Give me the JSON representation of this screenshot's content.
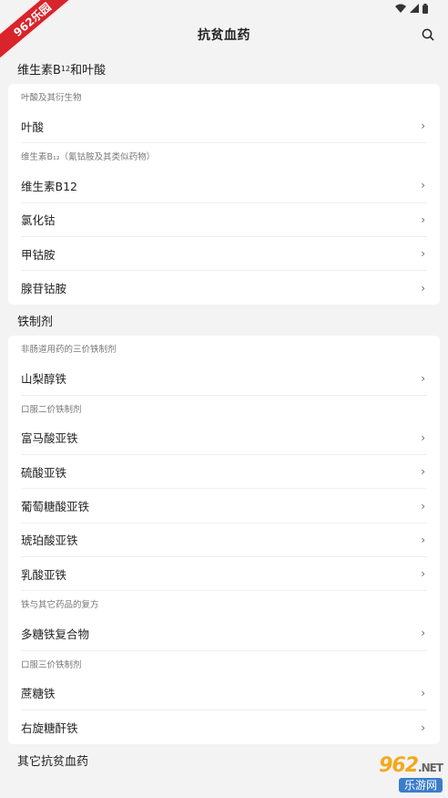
{
  "app": {
    "title": "抗贫血药"
  },
  "status": {
    "icons": [
      "wifi-icon",
      "signal-icon",
      "battery-icon"
    ]
  },
  "sections": [
    {
      "title_main": "维生素B",
      "title_sub": "12",
      "title_tail": "和叶酸",
      "groups": [
        {
          "subhead": "叶酸及其衍生物",
          "items": [
            "叶酸"
          ]
        },
        {
          "subhead": "维生素B₁₂（氰钴胺及其类似药物）",
          "items": [
            "维生素B12",
            "氯化钴",
            "甲钴胺",
            "腺苷钴胺"
          ]
        }
      ]
    },
    {
      "title": "铁制剂",
      "groups": [
        {
          "subhead": "非肠道用药的三价铁制剂",
          "items": [
            "山梨醇铁"
          ]
        },
        {
          "subhead": "口服二价铁制剂",
          "items": [
            "富马酸亚铁",
            "硫酸亚铁",
            "葡萄糖酸亚铁",
            "琥珀酸亚铁",
            "乳酸亚铁"
          ]
        },
        {
          "subhead": "铁与其它药品的复方",
          "items": [
            "多糖铁复合物"
          ]
        },
        {
          "subhead": "口服三价铁制剂",
          "items": [
            "蔗糖铁",
            "右旋糖酐铁"
          ]
        }
      ]
    },
    {
      "title": "其它抗贫血药"
    }
  ],
  "chevron": "›",
  "badge": {
    "text": "962乐园"
  },
  "watermark": {
    "brand": "962",
    "suffix": ".NET",
    "sub": "乐游网"
  },
  "colors": {
    "background": "#f3f3f3",
    "card": "#ffffff",
    "badge": "#d8242b"
  }
}
